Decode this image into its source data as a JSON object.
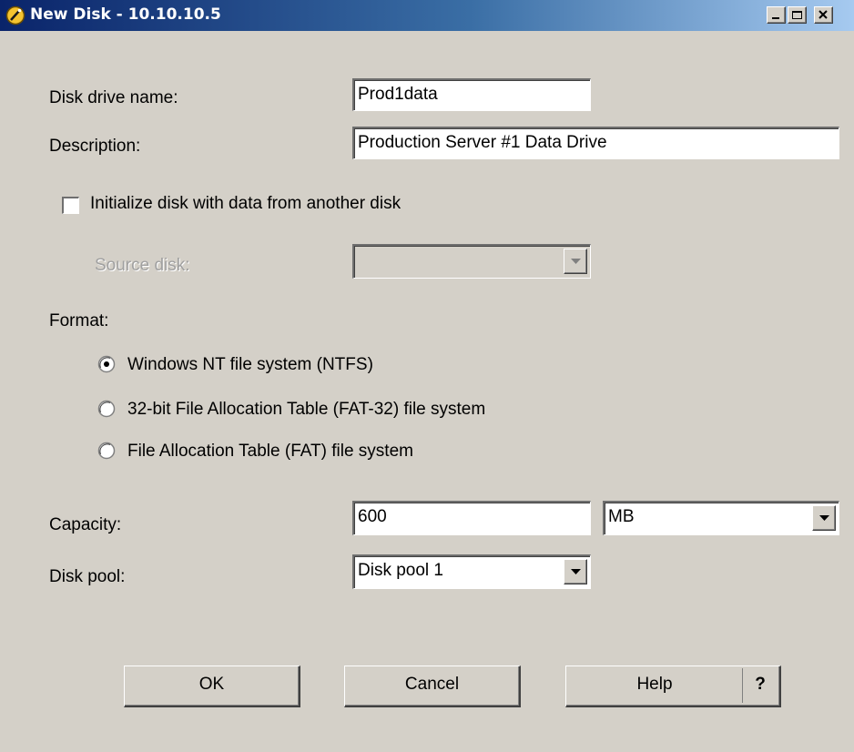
{
  "window": {
    "title": "New Disk - 10.10.10.5",
    "icon": "disk-wizard-icon",
    "controls": {
      "minimize": "minimize-icon",
      "maximize": "maximize-icon",
      "close": "close-icon"
    }
  },
  "form": {
    "disk_name": {
      "label": "Disk drive name:",
      "value": "Prod1data"
    },
    "description": {
      "label": "Description:",
      "value": "Production Server #1 Data Drive"
    },
    "initialize": {
      "label": "Initialize disk with data from another disk",
      "checked": false
    },
    "source_disk": {
      "label": "Source disk:",
      "value": "",
      "enabled": false
    },
    "format": {
      "label": "Format:",
      "options": [
        {
          "label": "Windows NT file system (NTFS)",
          "selected": true
        },
        {
          "label": "32-bit File Allocation Table (FAT-32) file system",
          "selected": false
        },
        {
          "label": "File Allocation Table (FAT) file system",
          "selected": false
        }
      ]
    },
    "capacity": {
      "label": "Capacity:",
      "value": "600",
      "unit": "MB"
    },
    "disk_pool": {
      "label": "Disk pool:",
      "value": "Disk pool 1"
    }
  },
  "buttons": {
    "ok": "OK",
    "cancel": "Cancel",
    "help": "Help",
    "help_q": "?"
  },
  "colors": {
    "face": "#d4d0c8",
    "title_start": "#0a246a",
    "title_end": "#a6caf0"
  }
}
